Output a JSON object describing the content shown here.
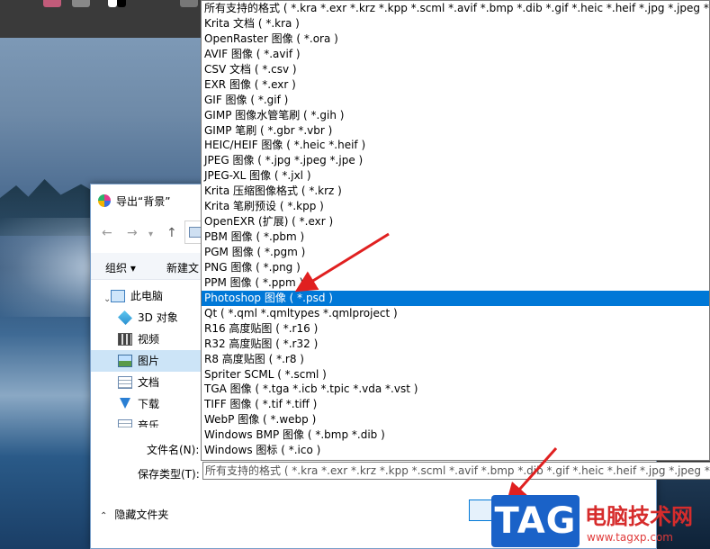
{
  "dialog": {
    "title": "导出“背景”",
    "organize_label": "组织 ▾",
    "new_folder_label": "新建文",
    "file_name_label": "文件名(N):",
    "save_type_label": "保存类型(T):",
    "save_type_value": "所有支持的格式 ( *.kra *.exr *.krz *.kpp *.scml *.avif *.bmp *.dib *.gif *.heic *.heif *.jpg *.jpeg *.jpe *",
    "hide_folders_label": "隐藏文件夹",
    "tree": [
      {
        "label": "此电脑",
        "icon": "computer-icon"
      },
      {
        "label": "3D 对象",
        "icon": "3d-objects-icon"
      },
      {
        "label": "视频",
        "icon": "video-icon"
      },
      {
        "label": "图片",
        "icon": "pictures-icon"
      },
      {
        "label": "文档",
        "icon": "documents-icon"
      },
      {
        "label": "下载",
        "icon": "downloads-icon"
      },
      {
        "label": "音乐",
        "icon": "music-icon"
      }
    ]
  },
  "dropdown": {
    "items": [
      "所有支持的格式 ( *.kra *.exr *.krz *.kpp *.scml *.avif *.bmp *.dib *.gif *.heic *.heif *.jpg *.jpeg *.jpe *",
      "Krita 文档 ( *.kra )",
      "OpenRaster 图像 ( *.ora )",
      "AVIF 图像 ( *.avif )",
      "CSV 文档 ( *.csv )",
      "EXR 图像 ( *.exr )",
      "GIF 图像 ( *.gif )",
      "GIMP 图像水管笔刷 ( *.gih )",
      "GIMP 笔刷 ( *.gbr *.vbr )",
      "HEIC/HEIF 图像 ( *.heic *.heif )",
      "JPEG 图像 ( *.jpg *.jpeg *.jpe )",
      "JPEG-XL 图像 ( *.jxl )",
      "Krita 压缩图像格式 ( *.krz )",
      "Krita 笔刷预设 ( *.kpp )",
      "OpenEXR (扩展) ( *.exr )",
      "PBM 图像 ( *.pbm )",
      "PGM 图像 ( *.pgm )",
      "PNG 图像 ( *.png )",
      "PPM 图像 ( *.ppm )",
      "Photoshop 图像 ( *.psd )",
      "Qt ( *.qml *.qmltypes *.qmlproject )",
      "R16 高度贴图 ( *.r16 )",
      "R32 高度贴图 ( *.r32 )",
      "R8 高度贴图 ( *.r8 )",
      "Spriter SCML ( *.scml )",
      "TGA 图像 ( *.tga *.icb *.tpic *.vda *.vst )",
      "TIFF 图像 ( *.tif *.tiff )",
      "WebP 图像 ( *.webp )",
      "Windows BMP 图像 ( *.bmp *.dib )",
      "Windows 图标 ( *.ico )"
    ],
    "selected_index": 19
  },
  "watermark": {
    "tag": "TAG",
    "site_name": "电脑技术网",
    "url": "www.tagxp.com"
  },
  "colors": {
    "selection": "#0078d7",
    "arrow": "#e02020",
    "watermark_blue": "#1a62c8",
    "watermark_red": "#d62c2c"
  }
}
